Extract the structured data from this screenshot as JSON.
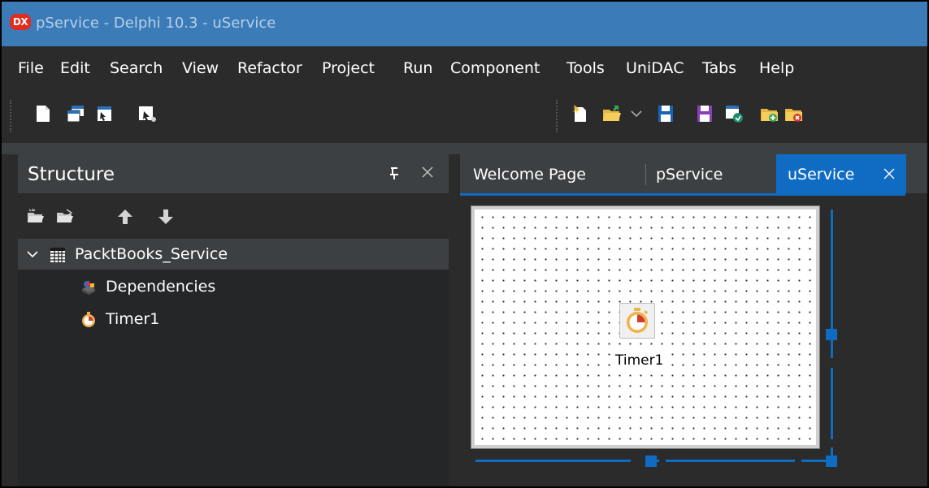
{
  "window": {
    "logo": "DX",
    "title": "pService - Delphi 10.3 - uService"
  },
  "menu": [
    "File",
    "Edit",
    "Search",
    "View",
    "Refactor",
    "Project",
    "Run",
    "Component",
    "Tools",
    "UniDAC",
    "Tabs",
    "Help"
  ],
  "toolbar": {
    "left_icons": [
      "new-file-icon",
      "new-window-icon",
      "new-form-icon",
      "run-tool-icon"
    ],
    "right_icons": [
      "new-items-icon",
      "open-icon",
      "dropdown-chevron-icon",
      "save-icon",
      "save-as-icon",
      "save-all-icon",
      "open-project-icon",
      "add-to-project-icon",
      "remove-from-project-icon"
    ]
  },
  "structure": {
    "title": "Structure",
    "toolbar_icons": [
      "expand-all-icon",
      "collapse-all-icon",
      "move-up-icon",
      "move-down-icon"
    ],
    "tree": [
      {
        "label": "PacktBooks_Service",
        "icon": "service-module-icon",
        "expanded": true,
        "selected": true
      },
      {
        "label": "Dependencies",
        "icon": "dependencies-icon"
      },
      {
        "label": "Timer1",
        "icon": "timer-icon"
      }
    ]
  },
  "tabs": [
    {
      "label": "Welcome Page",
      "active": false
    },
    {
      "label": "pService",
      "active": false
    },
    {
      "label": "uService",
      "active": true
    }
  ],
  "designer": {
    "component_label": "Timer1",
    "component_icon": "timer-icon"
  },
  "colors": {
    "title_bar": "#3a7bb8",
    "accent": "#0f6cc2",
    "panel": "#252628",
    "header": "#3c4043",
    "background": "#2b2b2b"
  }
}
